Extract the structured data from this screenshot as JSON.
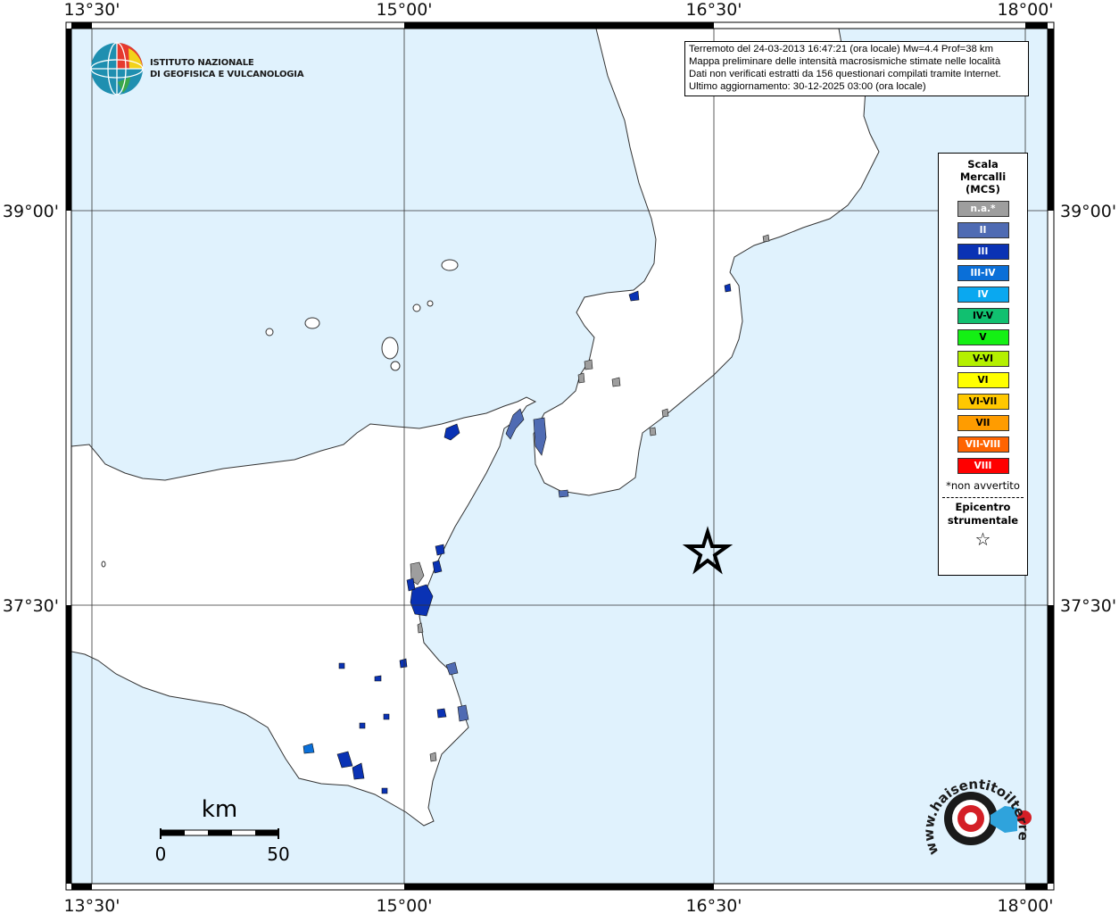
{
  "map": {
    "lon_ticks": [
      "13°30'",
      "15°00'",
      "16°30'",
      "18°00'"
    ],
    "lat_ticks": [
      "39°00'",
      "37°30'"
    ],
    "colors": {
      "sea": "#e0f2fd",
      "land": "#ffffff",
      "frame": "#000000"
    }
  },
  "info": {
    "line1": "Terremoto del 24-03-2013 16:47:21 (ora locale) Mw=4.4 Prof=38 km",
    "line2": "Mappa preliminare delle intensità macrosismiche stimate nelle località",
    "line3": "Dati non verificati estratti da 156 questionari compilati tramite Internet.",
    "line4": "Ultimo aggiornamento: 30-12-2025 03:00 (ora locale)"
  },
  "legend": {
    "title_line1": "Scala",
    "title_line2": "Mercalli",
    "title_line3": "(MCS)",
    "items": [
      {
        "label": "n.a.*",
        "color": "#9e9e9e"
      },
      {
        "label": "II",
        "color": "#4f6bb3"
      },
      {
        "label": "III",
        "color": "#0a32b4"
      },
      {
        "label": "III-IV",
        "color": "#0a6fd8"
      },
      {
        "label": "IV",
        "color": "#0aa8f0"
      },
      {
        "label": "IV-V",
        "color": "#11c070"
      },
      {
        "label": "V",
        "color": "#14f014"
      },
      {
        "label": "V-VI",
        "color": "#b4f000"
      },
      {
        "label": "VI",
        "color": "#ffff00"
      },
      {
        "label": "VI-VII",
        "color": "#ffc800"
      },
      {
        "label": "VII",
        "color": "#ff9c00"
      },
      {
        "label": "VII-VIII",
        "color": "#ff6400"
      },
      {
        "label": "VIII",
        "color": "#ff0000"
      }
    ],
    "note": "*non avvertito",
    "epicenter_line1": "Epicentro",
    "epicenter_line2": "strumentale",
    "epicenter_symbol": "☆"
  },
  "scale_bar": {
    "unit": "km",
    "start": "0",
    "end": "50"
  },
  "ingv": {
    "line1": "ISTITUTO NAZIONALE",
    "line2": "DI GEOFISICA E VULCANOLOGIA"
  },
  "haisentito": {
    "text": "www.haisentitoilterremoto.it"
  }
}
